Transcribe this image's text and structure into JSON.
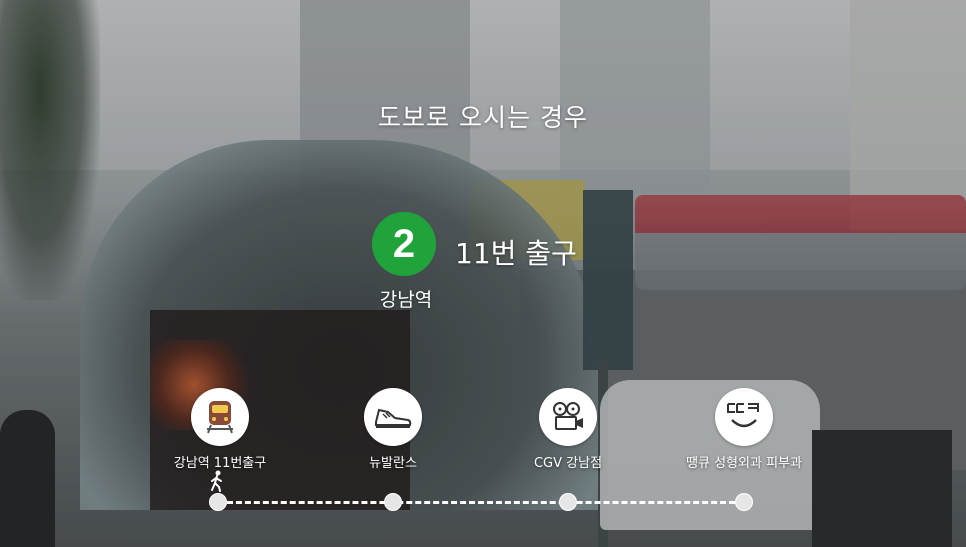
{
  "title": "도보로 오시는 경우",
  "station": {
    "line_number": "2",
    "line_color": "#1fa33a",
    "exit": "11번 출구",
    "name": "강남역"
  },
  "route": {
    "steps": [
      {
        "label": "강남역 11번출구",
        "icon": "subway-train-icon"
      },
      {
        "label": "뉴발란스",
        "icon": "sneaker-icon"
      },
      {
        "label": "CGV 강남점",
        "icon": "film-projector-icon"
      },
      {
        "label": "땡큐 성형외과 피부과",
        "icon": "smiley-logo-icon"
      }
    ]
  }
}
